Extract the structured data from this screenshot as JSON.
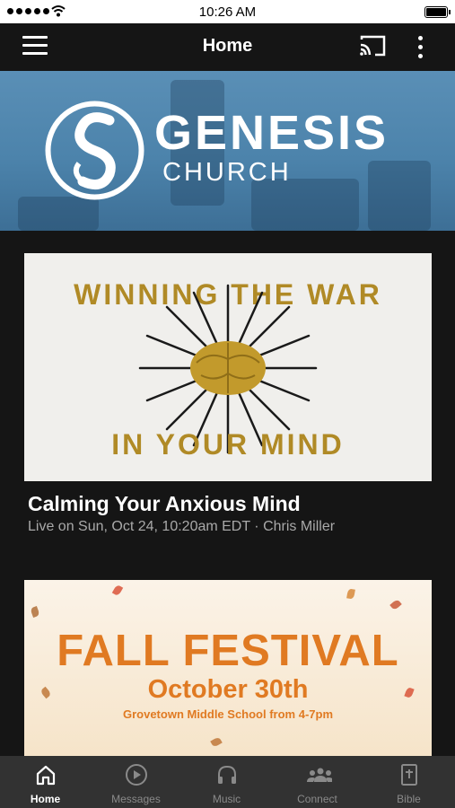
{
  "status_bar": {
    "time": "10:26 AM"
  },
  "header": {
    "title": "Home",
    "menu_icon": "hamburger-menu-icon",
    "cast_icon": "cast-icon",
    "more_icon": "more-vertical-icon"
  },
  "hero": {
    "brand_name": "GENESIS",
    "brand_sub": "CHURCH",
    "background_color": "#5a8fb6"
  },
  "sermon_card": {
    "image_line1": "WINNING THE WAR",
    "image_line2": "IN YOUR MIND",
    "title": "Calming Your Anxious Mind",
    "meta": "Live on Sun, Oct 24, 10:20am EDT · Chris Miller"
  },
  "event_card": {
    "title": "FALL FESTIVAL",
    "date": "October 30th",
    "location": "Grovetown Middle School from 4-7pm"
  },
  "tabs": [
    {
      "label": "Home",
      "icon": "home-icon",
      "active": true
    },
    {
      "label": "Messages",
      "icon": "play-circle-icon",
      "active": false
    },
    {
      "label": "Music",
      "icon": "headphones-icon",
      "active": false
    },
    {
      "label": "Connect",
      "icon": "people-icon",
      "active": false
    },
    {
      "label": "Bible",
      "icon": "bible-icon",
      "active": false
    }
  ],
  "colors": {
    "accent_gold": "#b08a26",
    "festival_orange": "#e07a22",
    "tab_bar": "#323232"
  }
}
